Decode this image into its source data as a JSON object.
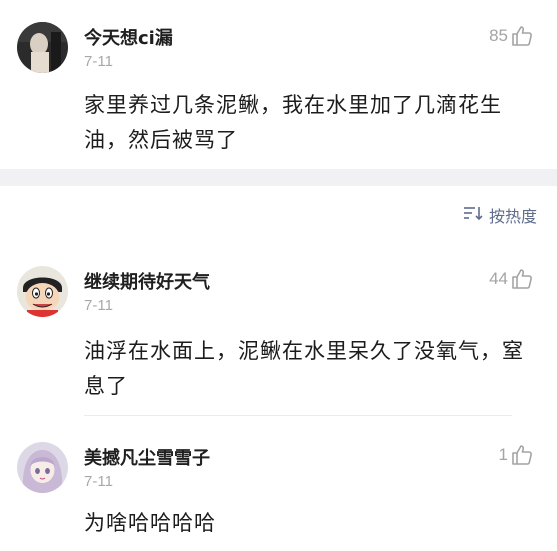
{
  "comments": [
    {
      "username": "今天想ci漏",
      "date": "7-11",
      "likes": "85",
      "text": "家里养过几条泥鳅，我在水里加了几滴花生油，然后被骂了",
      "avatar": "dark-photo-avatar"
    },
    {
      "username": "继续期待好天气",
      "date": "7-11",
      "likes": "44",
      "text": "油浮在水面上，泥鳅在水里呆久了没氧气，窒息了",
      "avatar": "cartoon-boy-avatar"
    },
    {
      "username": "美撼凡尘雪雪子",
      "date": "7-11",
      "likes": "1",
      "text": "为啥哈哈哈哈",
      "avatar": "anime-girl-avatar"
    }
  ],
  "sort": {
    "label": "按热度",
    "icon": "sort-icon"
  },
  "colors": {
    "accent": "#5f6c8c",
    "muted": "#a4a4a4",
    "separator": "#f1f1f3"
  }
}
